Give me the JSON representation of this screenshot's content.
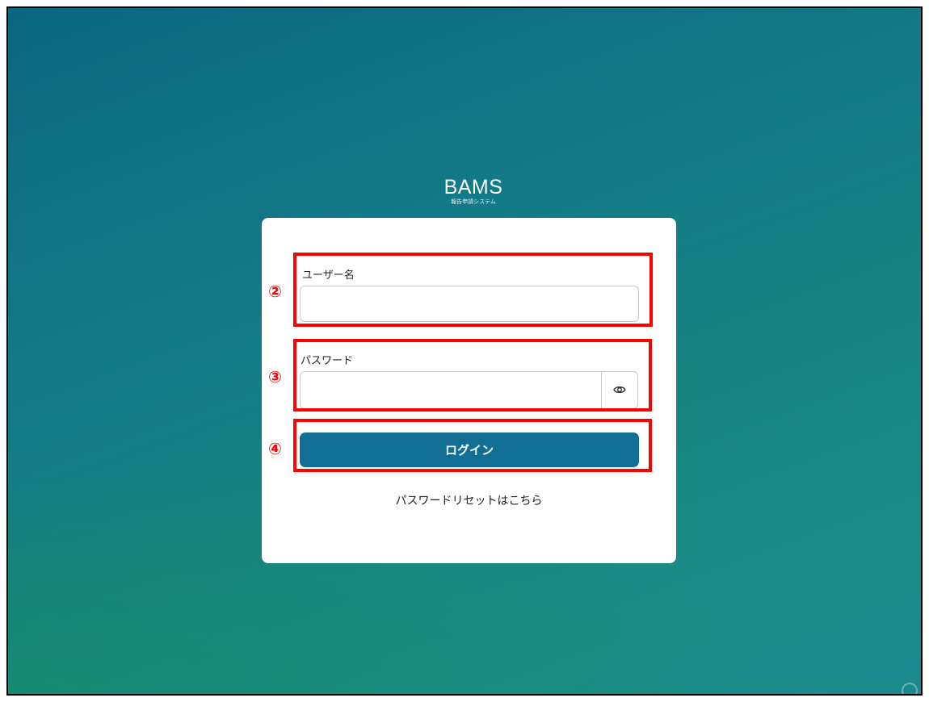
{
  "app": {
    "title": "BAMS",
    "subtitle": "報告申請システム"
  },
  "form": {
    "username_label": "ユーザー名",
    "username_value": "",
    "password_label": "パスワード",
    "password_value": "",
    "toggle_icon": "eye-icon",
    "login_label": "ログイン",
    "reset_link": "パスワードリセットはこちら"
  },
  "annotations": [
    {
      "number": "②",
      "target": "username"
    },
    {
      "number": "③",
      "target": "password"
    },
    {
      "number": "④",
      "target": "login"
    }
  ],
  "colors": {
    "background_top": "#0b6680",
    "background_bottom": "#1a8d86",
    "button": "#116f95",
    "annotation": "#ff0000"
  }
}
